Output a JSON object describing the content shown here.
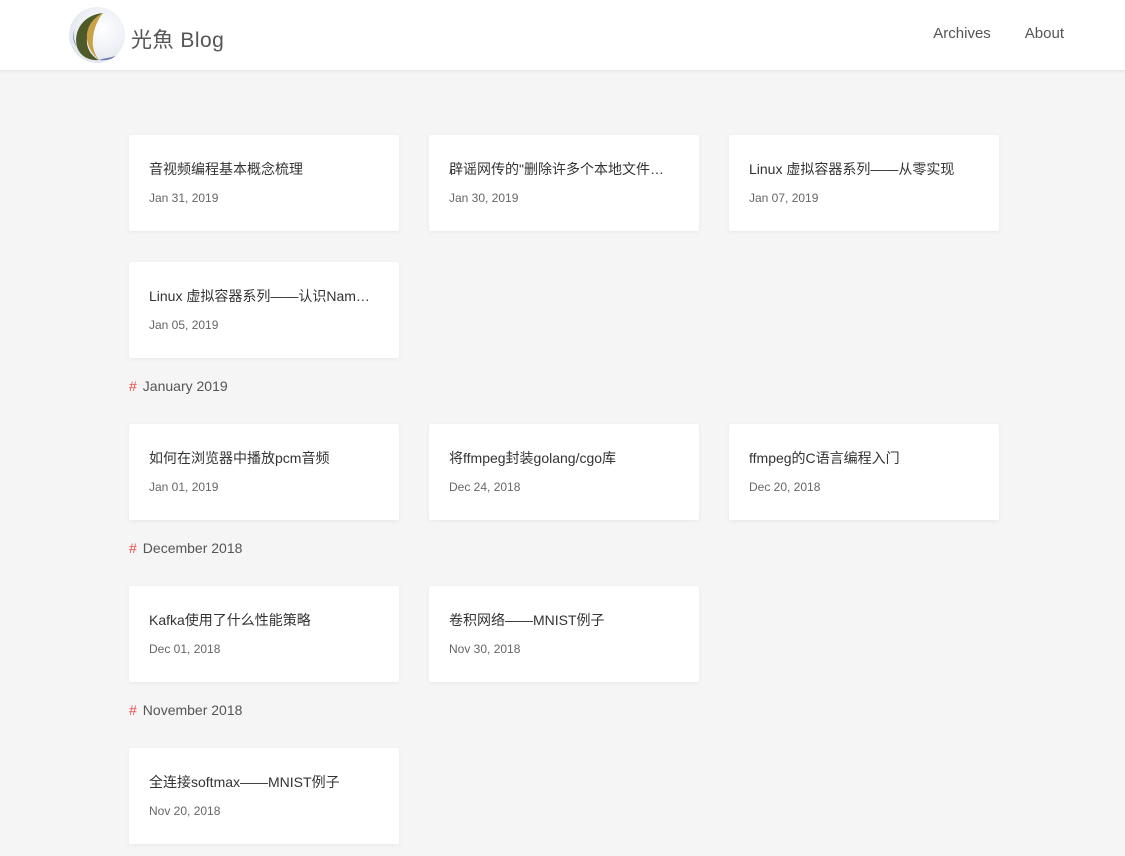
{
  "header": {
    "site_title": "光魚 Blog",
    "nav": [
      {
        "label": "Archives"
      },
      {
        "label": "About"
      }
    ]
  },
  "archive": {
    "hash_symbol": "#",
    "top_posts": [
      {
        "title": "音视频编程基本概念梳理",
        "date": "Jan 31, 2019"
      },
      {
        "title": "辟谣网传的\"删除许多个本地文件…",
        "date": "Jan 30, 2019"
      },
      {
        "title": "Linux 虚拟容器系列——从零实现",
        "date": "Jan 07, 2019"
      },
      {
        "title": "Linux 虚拟容器系列——认识Nam…",
        "date": "Jan 05, 2019"
      }
    ],
    "groups": [
      {
        "month": "January 2019",
        "posts": [
          {
            "title": "如何在浏览器中播放pcm音频",
            "date": "Jan 01, 2019"
          },
          {
            "title": "将ffmpeg封装golang/cgo库",
            "date": "Dec 24, 2018"
          },
          {
            "title": "ffmpeg的C语言编程入门",
            "date": "Dec 20, 2018"
          }
        ]
      },
      {
        "month": "December 2018",
        "posts": [
          {
            "title": "Kafka使用了什么性能策略",
            "date": "Dec 01, 2018"
          },
          {
            "title": "卷积网络——MNIST例子",
            "date": "Nov 30, 2018"
          }
        ]
      },
      {
        "month": "November 2018",
        "posts": [
          {
            "title": "全连接softmax——MNIST例子",
            "date": "Nov 20, 2018"
          }
        ]
      }
    ]
  },
  "colors": {
    "background": "#f5f5f5",
    "card": "#ffffff",
    "accent_hash": "#e64a4a"
  }
}
